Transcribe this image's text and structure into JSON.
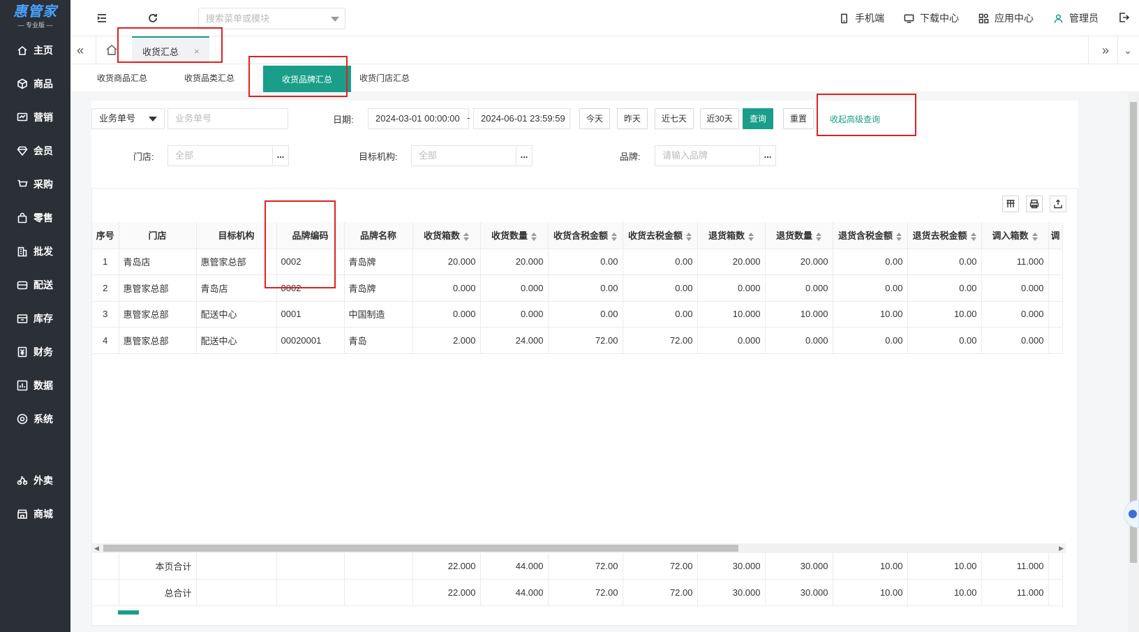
{
  "brand": {
    "name": "惠管家",
    "edition": "专业版"
  },
  "sidebar": {
    "items": [
      {
        "label": "主页",
        "icon": "home-icon"
      },
      {
        "label": "商品",
        "icon": "cube-icon"
      },
      {
        "label": "营销",
        "icon": "chart-icon"
      },
      {
        "label": "会员",
        "icon": "diamond-icon"
      },
      {
        "label": "采购",
        "icon": "cart-icon"
      },
      {
        "label": "零售",
        "icon": "bag-icon"
      },
      {
        "label": "批发",
        "icon": "building-icon"
      },
      {
        "label": "配送",
        "icon": "truck-icon"
      },
      {
        "label": "库存",
        "icon": "box-icon"
      },
      {
        "label": "财务",
        "icon": "yuan-icon"
      },
      {
        "label": "数据",
        "icon": "bar-chart-icon"
      },
      {
        "label": "系统",
        "icon": "settings-icon"
      }
    ],
    "extra_items": [
      {
        "label": "外卖",
        "icon": "bike-icon"
      },
      {
        "label": "商城",
        "icon": "shop-icon"
      }
    ]
  },
  "topbar": {
    "search_placeholder": "搜索菜单或模块",
    "links": {
      "mobile": "手机端",
      "download": "下载中心",
      "apps": "应用中心",
      "user": "管理员"
    }
  },
  "tabs": {
    "active": "收货汇总",
    "close": "×"
  },
  "subtabs": [
    "收货商品汇总",
    "收货品类汇总",
    "收货品牌汇总",
    "收货门店汇总"
  ],
  "filters": {
    "doc_type": "业务单号",
    "doc_placeholder": "业务单号",
    "date_label": "日期:",
    "date_from": "2024-03-01 00:00:00",
    "date_sep": "-",
    "date_to": "2024-06-01 23:59:59",
    "btn_today": "今天",
    "btn_yesterday": "昨天",
    "btn_7": "近七天",
    "btn_30": "近30天",
    "btn_query": "查询",
    "btn_reset": "重置",
    "advanced": "收起高级查询",
    "store_label": "门店:",
    "store_value": "全部",
    "org_label": "目标机构:",
    "org_value": "全部",
    "brand_label": "品牌:",
    "brand_placeholder": "请输入品牌",
    "dots": "..."
  },
  "table": {
    "headers": [
      "序号",
      "门店",
      "目标机构",
      "品牌编码",
      "品牌名称",
      "收货箱数",
      "收货数量",
      "收货含税金额",
      "收货去税金额",
      "退货箱数",
      "退货数量",
      "退货含税金额",
      "退货去税金额",
      "调入箱数",
      "调"
    ],
    "rows": [
      [
        "1",
        "青岛店",
        "惠管家总部",
        "0002",
        "青岛牌",
        "20.000",
        "20.000",
        "0.00",
        "0.00",
        "20.000",
        "20.000",
        "0.00",
        "0.00",
        "11.000",
        ""
      ],
      [
        "2",
        "惠管家总部",
        "青岛店",
        "0002",
        "青岛牌",
        "0.000",
        "0.000",
        "0.00",
        "0.00",
        "0.000",
        "0.000",
        "0.00",
        "0.00",
        "0.000",
        ""
      ],
      [
        "3",
        "惠管家总部",
        "配送中心",
        "0001",
        "中国制造",
        "0.000",
        "0.000",
        "0.00",
        "0.00",
        "10.000",
        "10.000",
        "10.00",
        "10.00",
        "0.000",
        ""
      ],
      [
        "4",
        "惠管家总部",
        "配送中心",
        "00020001",
        "青岛",
        "2.000",
        "24.000",
        "72.00",
        "72.00",
        "0.000",
        "0.000",
        "0.00",
        "0.00",
        "0.000",
        ""
      ]
    ],
    "footer": [
      {
        "label": "本页合计",
        "values": [
          "22.000",
          "44.000",
          "72.00",
          "72.00",
          "30.000",
          "30.000",
          "10.00",
          "10.00",
          "11.000"
        ]
      },
      {
        "label": "总合计",
        "values": [
          "22.000",
          "44.000",
          "72.00",
          "72.00",
          "30.000",
          "30.000",
          "10.00",
          "10.00",
          "11.000"
        ]
      }
    ]
  },
  "colors": {
    "accent": "#1a9e8a",
    "sidebar": "#2b2f36",
    "highlight": "#e02020"
  }
}
